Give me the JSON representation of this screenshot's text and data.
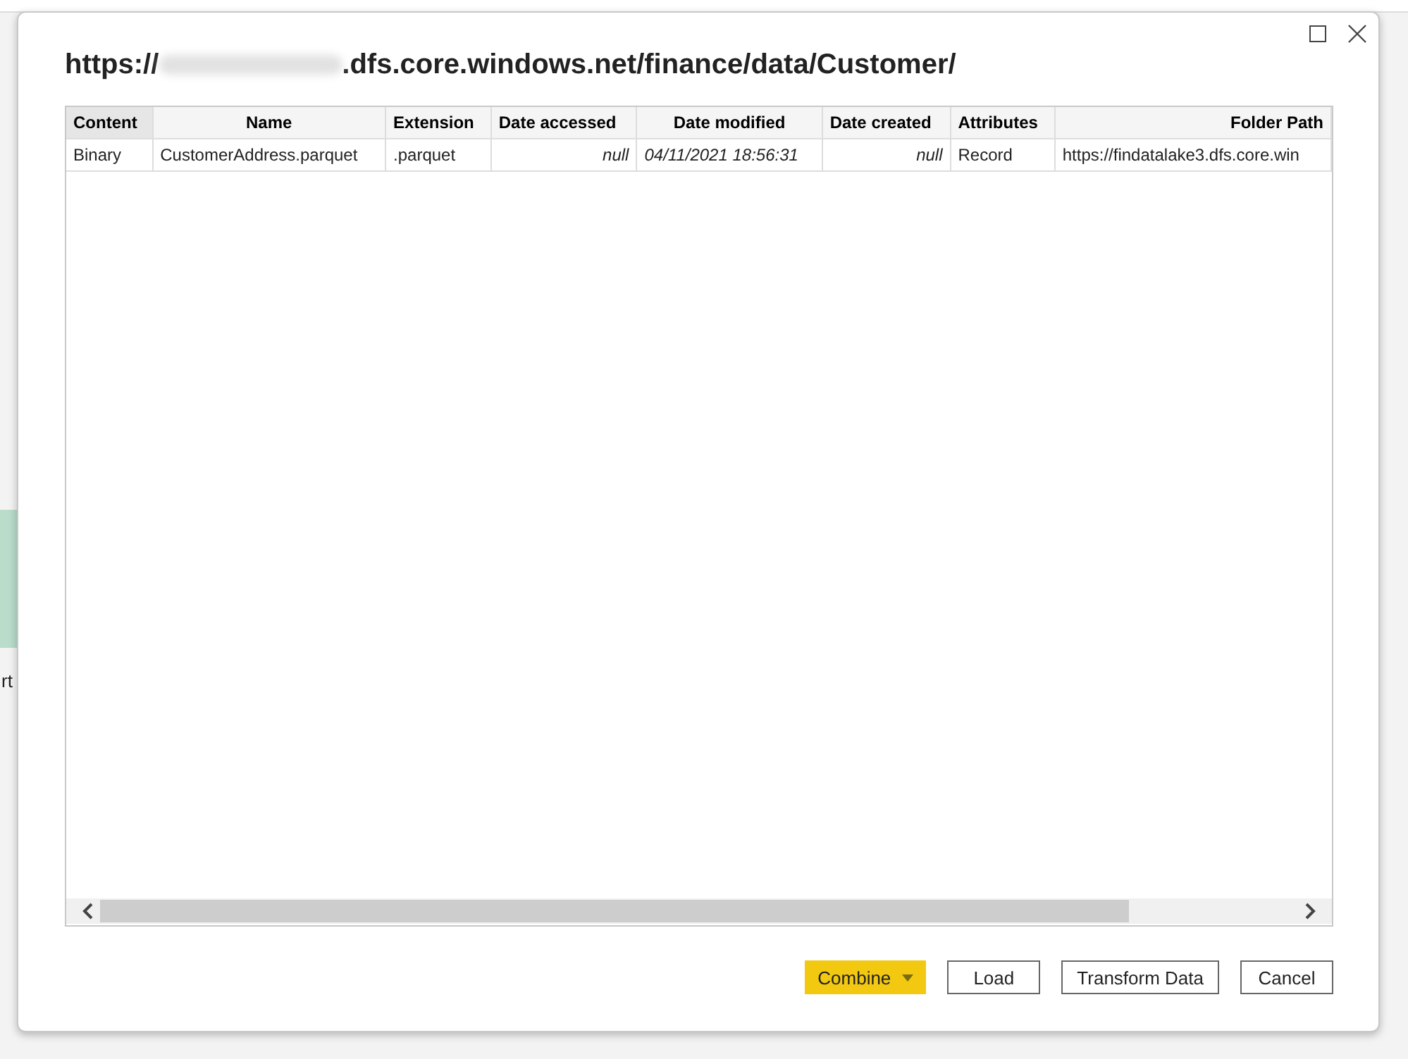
{
  "background": {
    "fragment_text": "rt"
  },
  "dialog": {
    "title_start": "https://",
    "title_end": ".dfs.core.windows.net/finance/data/Customer/",
    "table": {
      "columns": [
        {
          "label": "Content",
          "selected": true
        },
        {
          "label": "Name",
          "selected": false
        },
        {
          "label": "Extension",
          "selected": false
        },
        {
          "label": "Date accessed",
          "selected": false
        },
        {
          "label": "Date modified",
          "selected": false
        },
        {
          "label": "Date created",
          "selected": false
        },
        {
          "label": "Attributes",
          "selected": false
        },
        {
          "label": "Folder Path",
          "selected": false
        }
      ],
      "rows": [
        [
          "Binary",
          "CustomerAddress.parquet",
          ".parquet",
          "null",
          "04/11/2021 18:56:31",
          "null",
          "Record",
          "https://findatalake3.dfs.core.win"
        ]
      ]
    },
    "buttons": [
      {
        "label": "Combine",
        "kind": "primary",
        "dropdown": true
      },
      {
        "label": "Load",
        "kind": "default",
        "dropdown": false
      },
      {
        "label": "Transform Data",
        "kind": "default",
        "dropdown": false
      },
      {
        "label": "Cancel",
        "kind": "default",
        "dropdown": false
      }
    ]
  }
}
